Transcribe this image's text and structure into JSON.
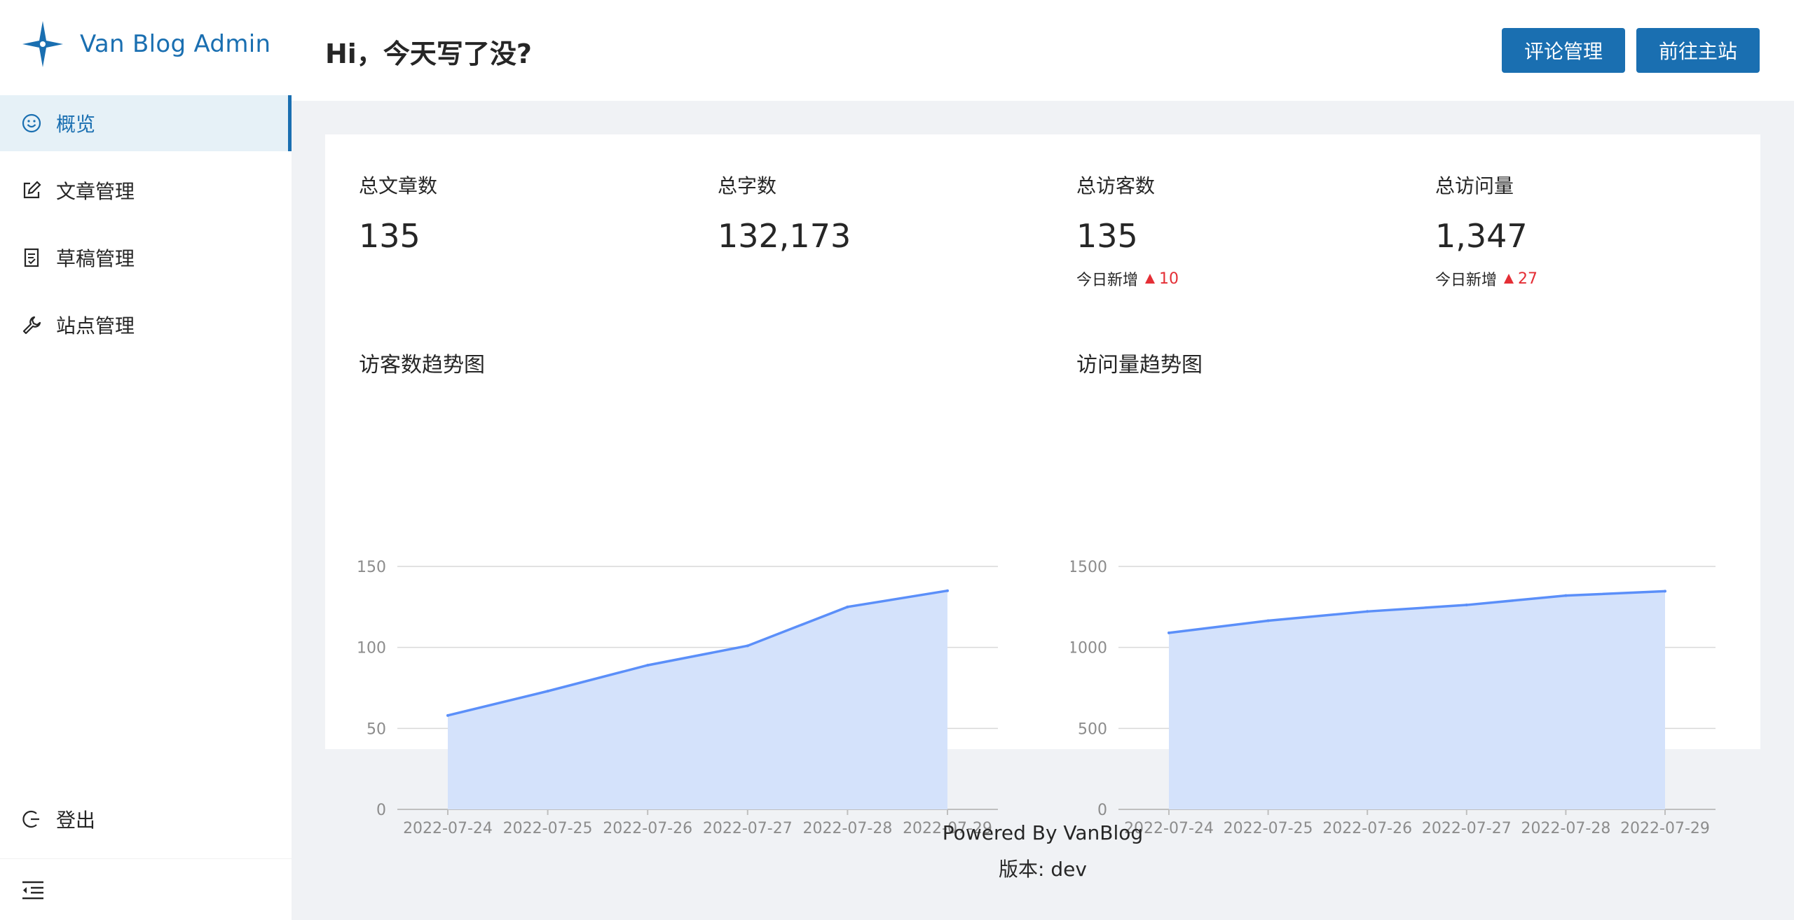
{
  "sidebar": {
    "logo_text": "Van Blog Admin",
    "menu": [
      {
        "label": "概览",
        "icon": "smile-icon",
        "active": true
      },
      {
        "label": "文章管理",
        "icon": "edit-icon",
        "active": false
      },
      {
        "label": "草稿管理",
        "icon": "document-icon",
        "active": false
      },
      {
        "label": "站点管理",
        "icon": "wrench-icon",
        "active": false
      }
    ],
    "logout_label": "登出",
    "collapse_icon": "menu-fold-icon"
  },
  "header": {
    "greeting": "Hi，今天写了没?",
    "comments_button": "评论管理",
    "site_button": "前往主站"
  },
  "stats": [
    {
      "label": "总文章数",
      "value": "135"
    },
    {
      "label": "总字数",
      "value": "132,173"
    },
    {
      "label": "总访客数",
      "value": "135",
      "sub_label": "今日新增",
      "sub_value": "10"
    },
    {
      "label": "总访问量",
      "value": "1,347",
      "sub_label": "今日新增",
      "sub_value": "27"
    }
  ],
  "charts": {
    "visitor_title": "访客数趋势图",
    "pv_title": "访问量趋势图"
  },
  "chart_data": [
    {
      "type": "area",
      "title": "访客数趋势图",
      "categories": [
        "2022-07-24",
        "2022-07-25",
        "2022-07-26",
        "2022-07-27",
        "2022-07-28",
        "2022-07-29"
      ],
      "values": [
        58,
        73,
        89,
        101,
        125,
        135
      ],
      "yticks": [
        0,
        50,
        100,
        150
      ],
      "ylim": [
        0,
        150
      ],
      "grid": true,
      "line_color": "#5b8ff9",
      "fill_color": "#d4e2fb"
    },
    {
      "type": "area",
      "title": "访问量趋势图",
      "categories": [
        "2022-07-24",
        "2022-07-25",
        "2022-07-26",
        "2022-07-27",
        "2022-07-28",
        "2022-07-29"
      ],
      "values": [
        1090,
        1165,
        1222,
        1262,
        1320,
        1347
      ],
      "yticks": [
        0,
        500,
        1000,
        1500
      ],
      "ylim": [
        0,
        1500
      ],
      "grid": true,
      "line_color": "#5b8ff9",
      "fill_color": "#d4e2fb"
    }
  ],
  "footer": {
    "powered_by": "Powered By VanBlog",
    "version": "版本: dev"
  },
  "colors": {
    "brand": "#1a6fb1",
    "increase": "#e42e35",
    "background": "#f0f2f5"
  }
}
